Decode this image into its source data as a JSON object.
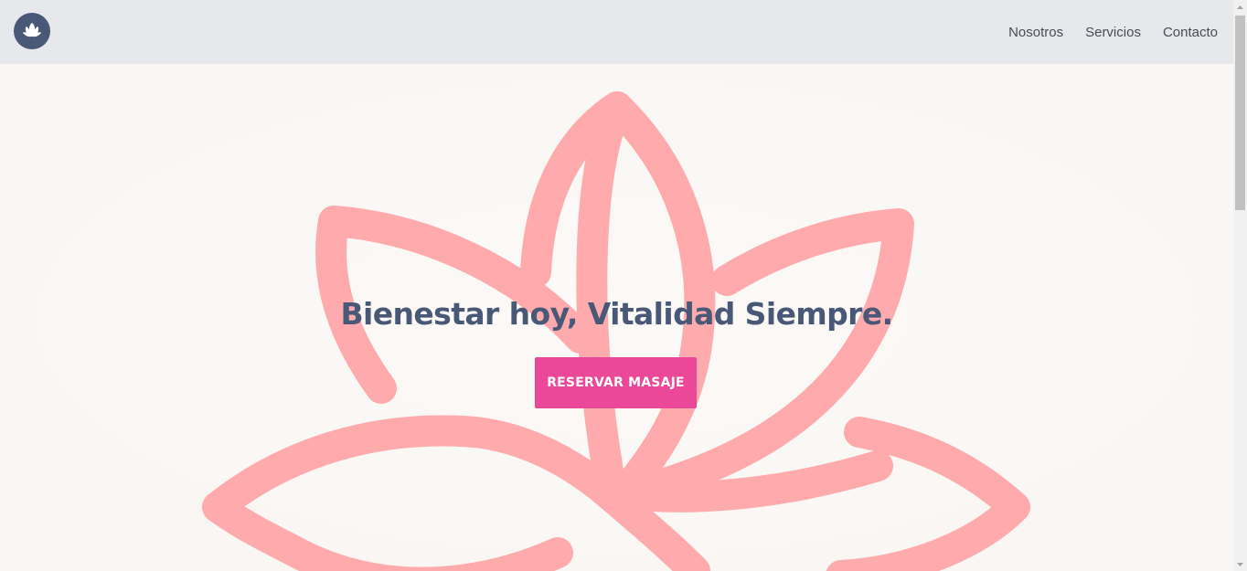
{
  "header": {
    "logo_icon": "lotus-icon",
    "nav": [
      {
        "label": "Nosotros"
      },
      {
        "label": "Servicios"
      },
      {
        "label": "Contacto"
      }
    ]
  },
  "hero": {
    "background_icon": "lotus-icon",
    "headline": "Bienestar hoy, Vitalidad Siempre.",
    "cta_label": "RESERVAR MASAJE"
  },
  "colors": {
    "header_bg": "#e6e8ec",
    "page_bg": "#faf7f4",
    "brand_dark": "#4a5877",
    "accent_pink": "#ec4899",
    "lotus_pink": "#ffaaad"
  }
}
